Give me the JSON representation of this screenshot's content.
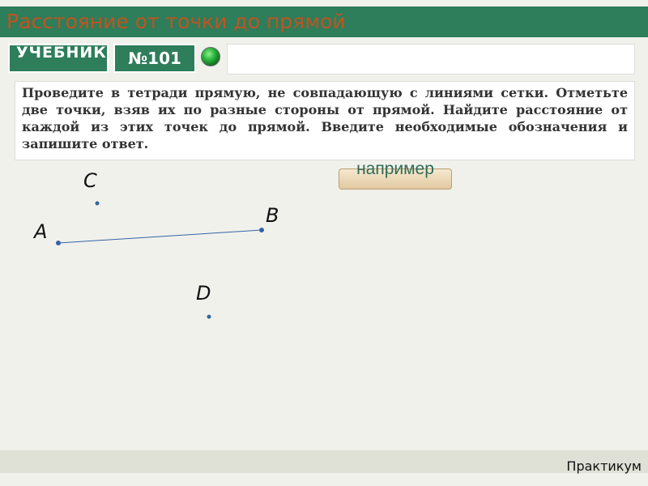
{
  "header": {
    "title": "Расстояние от точки до прямой"
  },
  "toolbar": {
    "textbook_label": "УЧЕБНИК",
    "task_number": "№101",
    "answer_value": ""
  },
  "task": {
    "text": "Проведите в тетради прямую, не совпадающую с линиями сетки. Отметьте две точки, взяв их по разные стороны от прямой. Найдите расстояние от каждой из этих точек до прямой. Введите необходимые обозначения и запишите ответ."
  },
  "example_button": {
    "label": "например"
  },
  "drawing": {
    "points": {
      "A": "A",
      "B": "B",
      "C": "C",
      "D": "D"
    }
  },
  "footer": {
    "label": "Практикум"
  },
  "colors": {
    "header_green": "#2e7d5b",
    "title_orange": "#c0541f",
    "point_blue": "#3465a4"
  }
}
